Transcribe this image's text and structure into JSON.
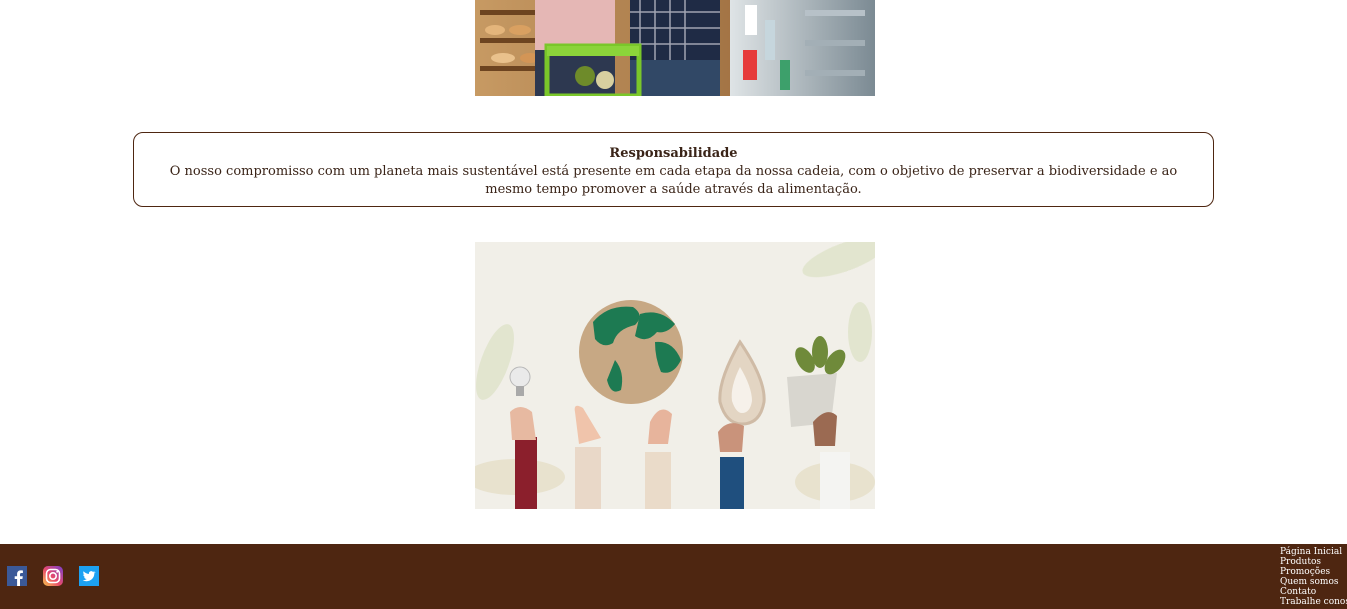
{
  "responsibility": {
    "title": "Responsabilidade",
    "text": "O nosso compromisso com um planeta mais sustentável está presente em cada etapa da nossa cadeia, com o objetivo de preservar a biodiversidade e ao mesmo tempo promover a saúde através da alimentação."
  },
  "images": {
    "top": "supermarket-couple-photo",
    "bottom": "sustainability-hands-photo"
  },
  "footer": {
    "social": [
      "facebook-icon",
      "instagram-icon",
      "twitter-icon"
    ],
    "links": [
      "Página Inicial",
      "Produtos",
      "Promoções",
      "Quem somos",
      "Contato",
      "Trabalhe conosco"
    ]
  },
  "colors": {
    "brand_brown": "#4e2611",
    "text": "#3a2418"
  }
}
